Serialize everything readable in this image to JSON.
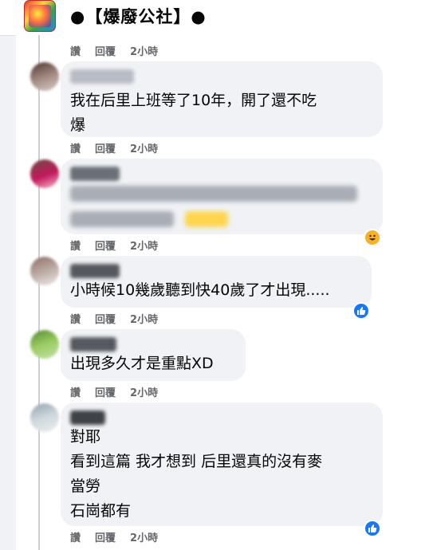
{
  "header": {
    "title": "●【爆廢公社】●"
  },
  "colors": {
    "bubble": "#f0f2f5",
    "meta": "#65676b",
    "like": "#1877f2",
    "haha": "#f7b125"
  },
  "action_labels": {
    "like": "讚",
    "reply": "回覆"
  },
  "comments": [
    {
      "time": "2小時"
    },
    {
      "text": "我在后里上班等了10年，開了還不吃\n爆",
      "time": "2小時"
    },
    {
      "text": "",
      "time": "2小時",
      "reaction": "haha-icon"
    },
    {
      "text": "小時候10幾歲聽到快40歲了才出現.....",
      "time": "2小時",
      "reaction": "like-icon"
    },
    {
      "text": "出現多久才是重點XD",
      "time": "2小時"
    },
    {
      "text": "對耶\n看到這篇 我才想到 后里還真的沒有麥\n當勞\n石崗都有",
      "time": "2小時",
      "reaction": "like-icon"
    }
  ]
}
